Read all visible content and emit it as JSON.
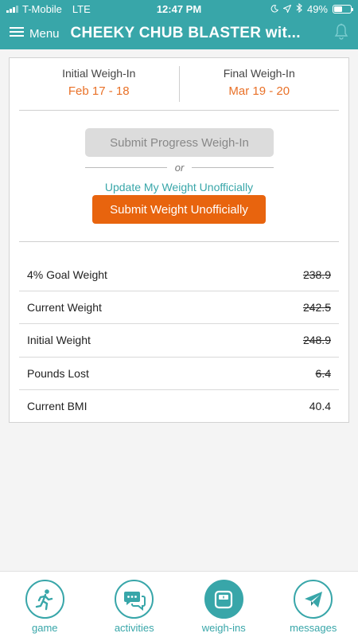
{
  "status_bar": {
    "carrier": "T-Mobile",
    "network": "LTE",
    "time": "12:47 PM",
    "battery": "49%",
    "battery_level": 0.49
  },
  "nav": {
    "menu_label": "Menu",
    "title": "CHEEKY CHUB BLASTER wit..."
  },
  "weigh_in": {
    "initial_label": "Initial Weigh-In",
    "initial_date": "Feb 17 - 18",
    "final_label": "Final Weigh-In",
    "final_date": "Mar 19 - 20"
  },
  "actions": {
    "progress_button": "Submit Progress Weigh-In",
    "or_text": "or",
    "update_link": "Update My Weight Unofficially",
    "submit_button": "Submit Weight Unofficially"
  },
  "stats": [
    {
      "label": "4% Goal Weight",
      "value": "238.9",
      "struck": true
    },
    {
      "label": "Current Weight",
      "value": "242.5",
      "struck": true
    },
    {
      "label": "Initial Weight",
      "value": "248.9",
      "struck": true
    },
    {
      "label": "Pounds Lost",
      "value": "6.4",
      "struck": true
    },
    {
      "label": "Current BMI",
      "value": "40.4",
      "struck": false
    }
  ],
  "tabs": [
    {
      "label": "game",
      "icon": "runner-icon",
      "active": false
    },
    {
      "label": "activities",
      "icon": "chat-bubbles-icon",
      "active": false
    },
    {
      "label": "weigh-ins",
      "icon": "scale-icon",
      "active": true
    },
    {
      "label": "messages",
      "icon": "paper-plane-icon",
      "active": false
    }
  ],
  "colors": {
    "teal": "#38a6a9",
    "orange": "#e97128",
    "orange_button": "#e8640e"
  }
}
